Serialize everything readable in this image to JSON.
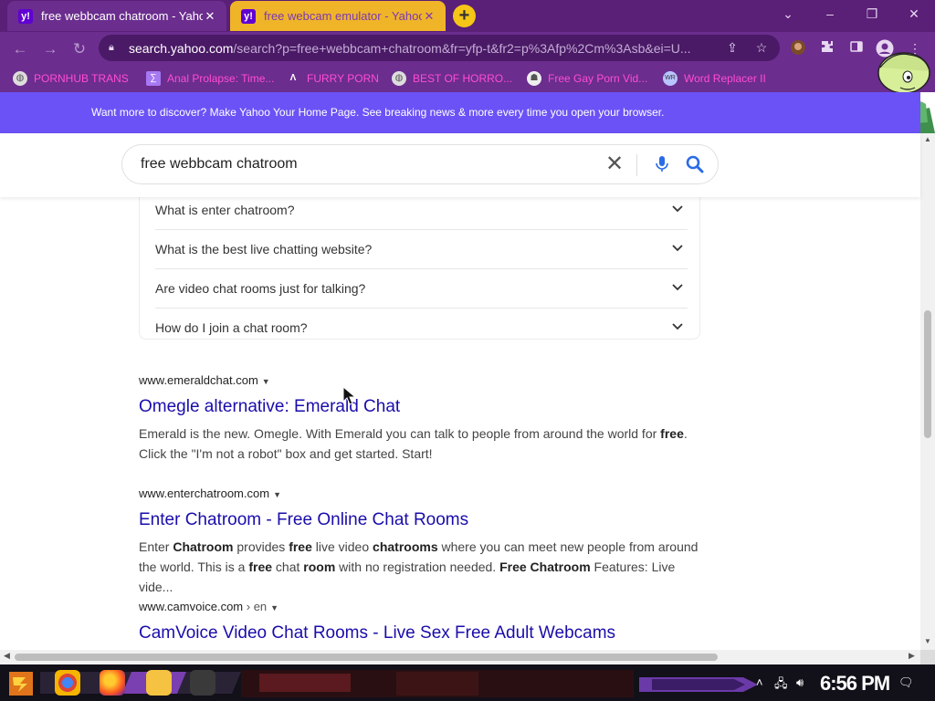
{
  "tabs": [
    {
      "title": "free webbcam chatroom - Yaho",
      "favicon": "yahoo-favicon",
      "active": true
    },
    {
      "title": "free webcam emulator - Yahoo",
      "favicon": "yahoo-favicon",
      "active": false
    }
  ],
  "address_bar": {
    "host": "search.yahoo.com",
    "path": "/search?p=free+webbcam+chatroom&fr=yfp-t&fr2=p%3Afp%2Cm%3Asb&ei=U..."
  },
  "bookmarks": [
    {
      "label": "PORNHUB TRANS",
      "icon": "globe-icon"
    },
    {
      "label": "Anal Prolapse: Time...",
      "icon": "bookmark-icon"
    },
    {
      "label": "FURRY PORN",
      "icon": "arrow-logo-icon"
    },
    {
      "label": "BEST OF HORRO...",
      "icon": "globe-icon"
    },
    {
      "label": "Free Gay Porn Vid...",
      "icon": "bookmark-icon"
    },
    {
      "label": "Word Replacer II",
      "icon": "wr-icon"
    }
  ],
  "banner": {
    "text": "Want more to discover? Make Yahoo Your Home Page. See breaking news & more every time you open your browser."
  },
  "search": {
    "query": "free webbcam chatroom"
  },
  "faq": [
    "What is enter chatroom?",
    "What is the best live chatting website?",
    "Are video chat rooms just for talking?",
    "How do I join a chat room?"
  ],
  "results": [
    {
      "site": "www.emeraldchat.com",
      "path": "",
      "title": "Omegle alternative: Emerald Chat",
      "snippet": [
        {
          "t": "Emerald is the new. Omegle. With Emerald you can talk to people from around the world for ",
          "b": false
        },
        {
          "t": "free",
          "b": true
        },
        {
          "t": ". Click the \"I'm not a robot\" box and get started. Start!",
          "b": false
        }
      ]
    },
    {
      "site": "www.enterchatroom.com",
      "path": "",
      "title": "Enter Chatroom - Free Online Chat Rooms",
      "snippet": [
        {
          "t": "Enter ",
          "b": false
        },
        {
          "t": "Chatroom",
          "b": true
        },
        {
          "t": " provides ",
          "b": false
        },
        {
          "t": "free",
          "b": true
        },
        {
          "t": " live video ",
          "b": false
        },
        {
          "t": "chatrooms",
          "b": true
        },
        {
          "t": " where you can meet new people from around the world. This is a ",
          "b": false
        },
        {
          "t": "free",
          "b": true
        },
        {
          "t": " chat ",
          "b": false
        },
        {
          "t": "room",
          "b": true
        },
        {
          "t": " with no registration needed. ",
          "b": false
        },
        {
          "t": "Free Chatroom",
          "b": true
        },
        {
          "t": " Features: Live vide...",
          "b": false
        }
      ]
    },
    {
      "site": "www.camvoice.com",
      "path": " › en",
      "title": "CamVoice Video Chat Rooms - Live Sex Free Adult Webcams",
      "snippet": []
    }
  ],
  "taskbar": {
    "time": "6:56 PM"
  },
  "colors": {
    "browser_frame": "#6b2d8e",
    "banner": "#6b52f6",
    "link": "#1a0dab",
    "bookmark_text": "#ff4dd2"
  }
}
